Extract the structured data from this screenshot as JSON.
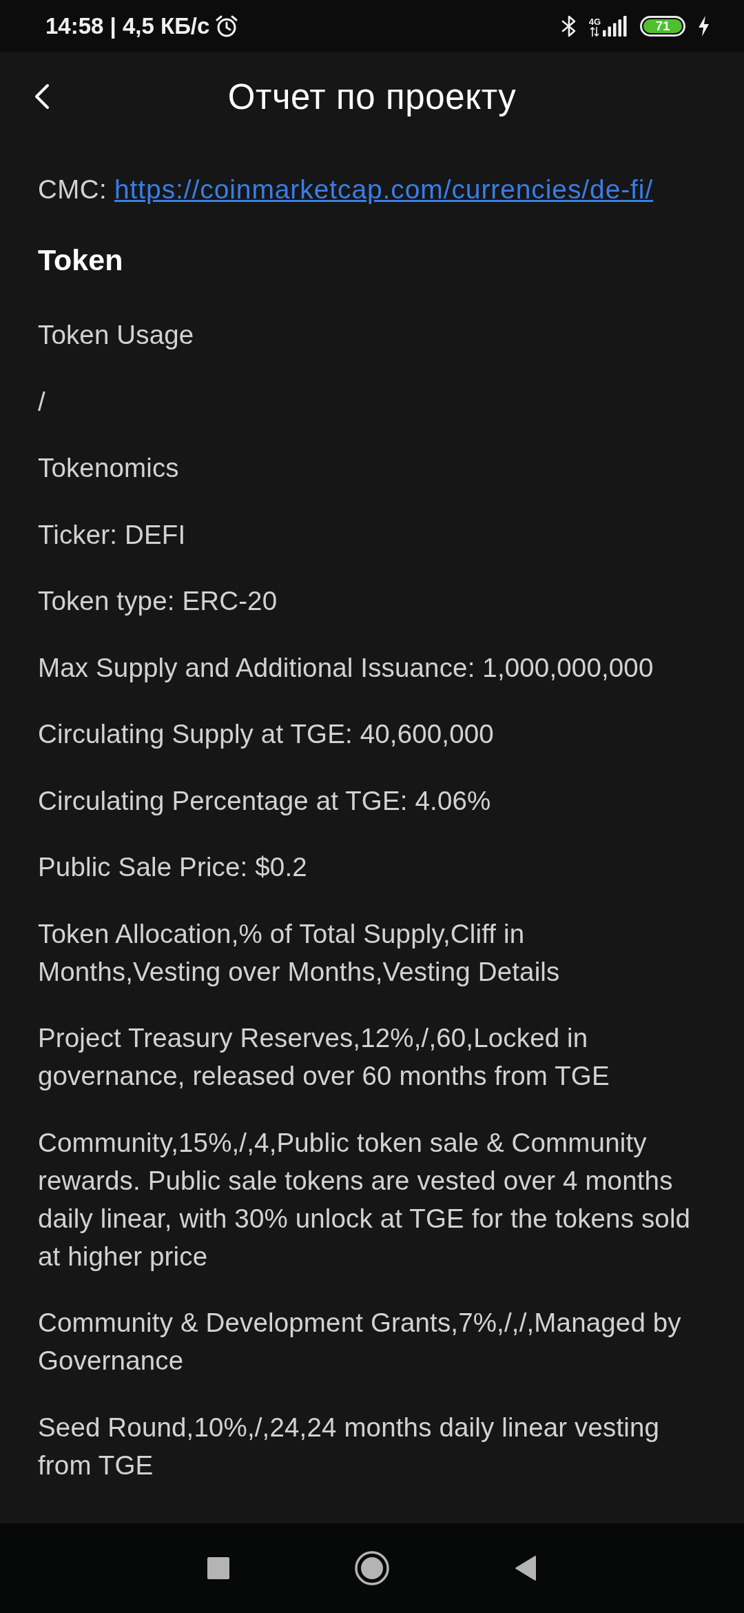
{
  "status_bar": {
    "time_and_speed": "14:58 | 4,5 КБ/с",
    "network": "4G",
    "battery": "71"
  },
  "header": {
    "title": "Отчет по проекту"
  },
  "content": [
    {
      "kind": "link_line",
      "label": "CMC:",
      "url": "https://coinmarketcap.com/currencies/de-fi/"
    },
    {
      "kind": "heading",
      "text": "Token"
    },
    {
      "kind": "paragraph",
      "text": "Token Usage"
    },
    {
      "kind": "paragraph",
      "text": "/"
    },
    {
      "kind": "paragraph",
      "text": "Tokenomics"
    },
    {
      "kind": "paragraph",
      "text": "Ticker: DEFI"
    },
    {
      "kind": "paragraph",
      "text": "Token type: ERC-20"
    },
    {
      "kind": "paragraph",
      "text": "Max Supply and Additional Issuance: 1,000,000,000"
    },
    {
      "kind": "paragraph",
      "text": "Circulating Supply at TGE: 40,600,000"
    },
    {
      "kind": "paragraph",
      "text": "Circulating Percentage at TGE: 4.06%"
    },
    {
      "kind": "paragraph",
      "text": "Public Sale Price: $0.2"
    },
    {
      "kind": "paragraph",
      "text": "Token Allocation,% of Total Supply,Cliff in Months,Vesting over Months,Vesting Details"
    },
    {
      "kind": "paragraph",
      "text": "Project Treasury Reserves,12%,/,60,Locked in governance, released over 60 months from TGE"
    },
    {
      "kind": "paragraph",
      "text": "Community,15%,/,4,Public token sale & Community rewards. Public sale tokens are vested over 4 months daily linear, with 30% unlock at TGE for the tokens sold at higher price"
    },
    {
      "kind": "paragraph",
      "text": "Community & Development Grants,7%,/,/,Managed by Governance"
    },
    {
      "kind": "paragraph",
      "text": "Seed Round,10%,/,24,24 months daily linear vesting from TGE"
    }
  ]
}
